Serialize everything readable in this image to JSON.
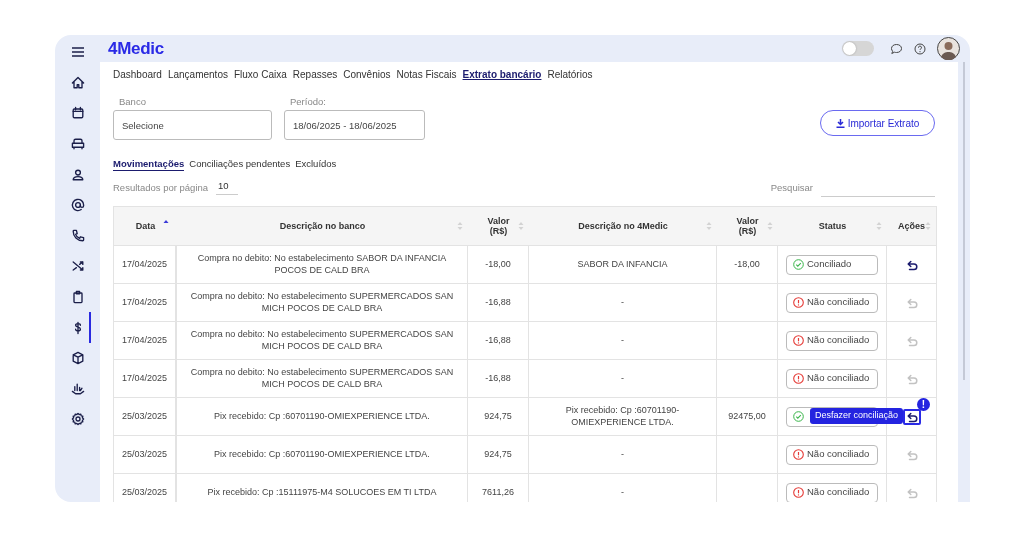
{
  "sidebar": {
    "items": [
      {
        "kind": "home",
        "selected": false
      },
      {
        "kind": "calendar",
        "selected": false
      },
      {
        "kind": "sofa",
        "selected": false
      },
      {
        "kind": "person",
        "selected": false
      },
      {
        "kind": "at",
        "selected": false
      },
      {
        "kind": "phone",
        "selected": false
      },
      {
        "kind": "shuffle",
        "selected": false
      },
      {
        "kind": "clipboard",
        "selected": false
      },
      {
        "kind": "dollar",
        "selected": true
      },
      {
        "kind": "box",
        "selected": false
      },
      {
        "kind": "chart",
        "selected": false
      },
      {
        "kind": "gear",
        "selected": false
      }
    ]
  },
  "header": {
    "logo": "4Medic",
    "toggle": {
      "on": false
    }
  },
  "nav": [
    {
      "label": "Dashboard",
      "selected": false
    },
    {
      "label": "Lançamentos",
      "selected": false
    },
    {
      "label": "Fluxo Caixa",
      "selected": false
    },
    {
      "label": "Repasses",
      "selected": false
    },
    {
      "label": "Convênios",
      "selected": false
    },
    {
      "label": "Notas Fiscais",
      "selected": false
    },
    {
      "label": "Extrato bancário",
      "selected": true
    },
    {
      "label": "Relatórios",
      "selected": false
    }
  ],
  "filters": [
    {
      "label": "Banco",
      "value": "Selecione"
    },
    {
      "label": "Período:",
      "value": "18/06/2025 - 18/06/2025"
    }
  ],
  "import_button": "Importar Extrato",
  "subtabs": [
    {
      "label": "Movimentações",
      "selected": true
    },
    {
      "label": "Conciliações pendentes",
      "selected": false
    },
    {
      "label": "Excluídos",
      "selected": false
    }
  ],
  "page_size": {
    "label": "Resultados por página",
    "value": "10"
  },
  "search": {
    "label": "Pesquisar"
  },
  "table": {
    "columns": [
      {
        "label": "Data",
        "sorted": true
      },
      {
        "label": "Descrição no banco",
        "sorted": false
      },
      {
        "label": "Valor (R$)",
        "sorted": false
      },
      {
        "label": "Descrição no 4Medic",
        "sorted": false
      },
      {
        "label": "Valor (R$)",
        "sorted": false
      },
      {
        "label": "Status",
        "sorted": false
      },
      {
        "label": "Ações",
        "sorted": false
      }
    ],
    "rows": [
      {
        "date": "17/04/2025",
        "bank_desc": "Compra no debito: No estabelecimento SABOR DA INFANCIA POCOS DE CALD BRA",
        "value": "-18,00",
        "medic_desc": "SABOR DA INFANCIA",
        "medic_value": "-18,00",
        "status": {
          "kind": "ok",
          "label": "Conciliado"
        },
        "action": {
          "enabled": true,
          "highlighted": false
        }
      },
      {
        "date": "17/04/2025",
        "bank_desc": "Compra no debito: No estabelecimento SUPERMERCADOS SAN MICH POCOS DE CALD BRA",
        "value": "-16,88",
        "medic_desc": "-",
        "status": {
          "kind": "pending",
          "label": "Não conciliado"
        },
        "action": {
          "enabled": false,
          "highlighted": false
        }
      },
      {
        "date": "17/04/2025",
        "bank_desc": "Compra no debito: No estabelecimento SUPERMERCADOS SAN MICH POCOS DE CALD BRA",
        "value": "-16,88",
        "medic_desc": "-",
        "status": {
          "kind": "pending",
          "label": "Não conciliado"
        },
        "action": {
          "enabled": false,
          "highlighted": false
        }
      },
      {
        "date": "17/04/2025",
        "bank_desc": "Compra no debito: No estabelecimento SUPERMERCADOS SAN MICH POCOS DE CALD BRA",
        "value": "-16,88",
        "medic_desc": "-",
        "status": {
          "kind": "pending",
          "label": "Não conciliado"
        },
        "action": {
          "enabled": false,
          "highlighted": false
        }
      },
      {
        "date": "25/03/2025",
        "bank_desc": "Pix recebido: Cp :60701190-OMIEXPERIENCE LTDA.",
        "value": "924,75",
        "medic_desc": "Pix recebido: Cp :60701190-OMIEXPERIENCE LTDA.",
        "medic_value": "92475,00",
        "status": {
          "kind": "ok"
        },
        "action": {
          "enabled": true,
          "highlighted": true,
          "tooltip": "Desfazer conciliação",
          "badge": "!"
        }
      },
      {
        "date": "25/03/2025",
        "bank_desc": "Pix recebido: Cp :60701190-OMIEXPERIENCE LTDA.",
        "value": "924,75",
        "medic_desc": "-",
        "status": {
          "kind": "pending",
          "label": "Não conciliado"
        },
        "action": {
          "enabled": false,
          "highlighted": false
        }
      },
      {
        "date": "25/03/2025",
        "bank_desc": "Pix recebido: Cp :15111975-M4 SOLUCOES EM TI LTDA",
        "value": "7611,26",
        "medic_desc": "-",
        "status": {
          "kind": "pending",
          "label": "Não conciliado"
        },
        "action": {
          "enabled": false,
          "highlighted": false
        }
      }
    ]
  }
}
